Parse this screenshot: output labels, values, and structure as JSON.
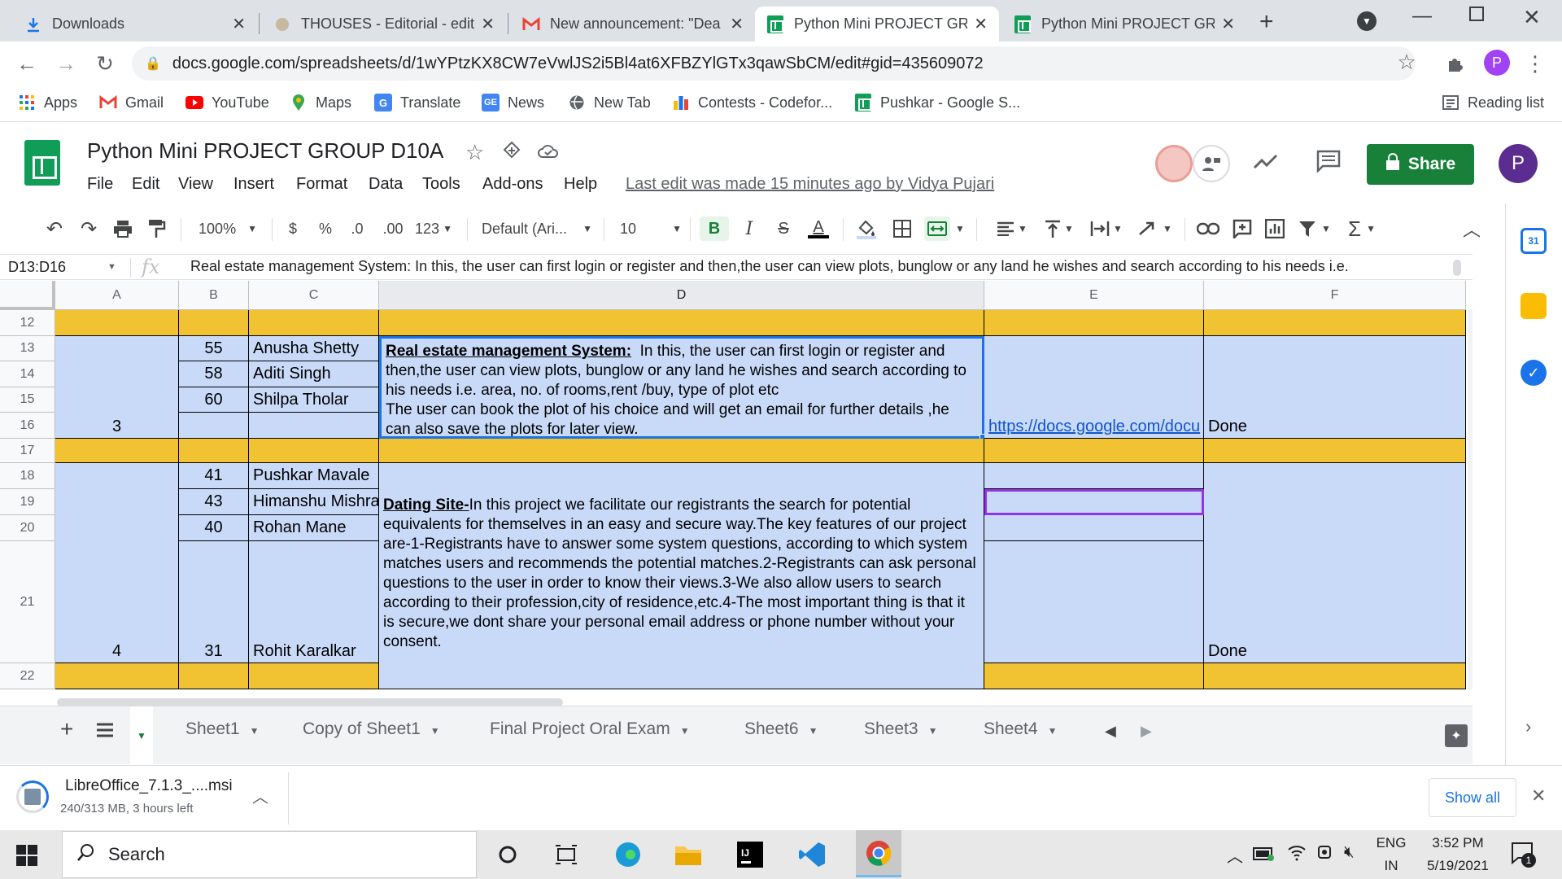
{
  "browser": {
    "tabs": [
      {
        "label": "Downloads",
        "icon": "download-icon"
      },
      {
        "label": "THOUSES - Editorial - edit",
        "icon": "thouses-icon"
      },
      {
        "label": "New announcement: \"Dea",
        "icon": "gmail-icon"
      },
      {
        "label": "Python Mini PROJECT GRO",
        "icon": "sheets-icon"
      },
      {
        "label": "Python Mini PROJECT GRO",
        "icon": "sheets-icon"
      }
    ],
    "url": "docs.google.com/spreadsheets/d/1wYPtzKX8CW7eVwlJS2i5Bl4at6XFBZYlGTx3qawSbCM/edit#gid=435609072",
    "profile_initial": "P",
    "bookmarks": [
      {
        "label": "Apps",
        "icon": "apps-grid-icon"
      },
      {
        "label": "Gmail",
        "icon": "gmail-icon"
      },
      {
        "label": "YouTube",
        "icon": "youtube-icon"
      },
      {
        "label": "Maps",
        "icon": "maps-icon"
      },
      {
        "label": "Translate",
        "icon": "translate-icon"
      },
      {
        "label": "News",
        "icon": "news-icon"
      },
      {
        "label": "New Tab",
        "icon": "globe-icon"
      },
      {
        "label": "Contests - Codefor...",
        "icon": "codeforces-icon"
      },
      {
        "label": "Pushkar - Google S...",
        "icon": "sheets-icon"
      }
    ],
    "reading_list": "Reading list"
  },
  "doc": {
    "title": "Python Mini PROJECT GROUP D10A",
    "menus": [
      "File",
      "Edit",
      "View",
      "Insert",
      "Format",
      "Data",
      "Tools",
      "Add-ons",
      "Help"
    ],
    "last_edit": "Last edit was made 15 minutes ago by Vidya Pujari",
    "share_label": "Share",
    "user_initial": "P"
  },
  "toolbar": {
    "zoom": "100%",
    "currency": "$",
    "percent": "%",
    "dec_less": ".0",
    "dec_more": ".00",
    "format_more": "123",
    "font": "Default (Ari...",
    "font_size": "10",
    "bold": "B",
    "italic": "I",
    "strike": "S",
    "text_color": "A"
  },
  "formula_bar": {
    "name_box": "D13:D16",
    "fx": "fx",
    "content": "Real estate management System:  In this, the user can first login or register and then,the user can view plots, bunglow or any land he wishes and search according to his needs i.e."
  },
  "grid": {
    "columns": [
      "A",
      "B",
      "C",
      "D",
      "E",
      "F"
    ],
    "rows": [
      "12",
      "13",
      "14",
      "15",
      "16",
      "17",
      "18",
      "19",
      "20",
      "21",
      "22"
    ],
    "group3": {
      "group_no": "3",
      "members": [
        {
          "roll": "55",
          "name": "Anusha Shetty"
        },
        {
          "roll": "58",
          "name": "Aditi Singh"
        },
        {
          "roll": "60",
          "name": "Shilpa Tholar"
        }
      ],
      "title": "Real estate management System:",
      "description": "  In this, the user can first login or register and then,the user can view plots, bunglow or any land he wishes and search according to his needs i.e. area, no. of rooms,rent /buy, type of plot etc\nThe user can book the plot of his choice and will get an email for further details ,he can also save the plots for later view.",
      "link": "https://docs.google.com/docu",
      "status": "Done"
    },
    "group4": {
      "group_no": "4",
      "members": [
        {
          "roll": "41",
          "name": "Pushkar Mavale"
        },
        {
          "roll": "43",
          "name": "Himanshu Mishra"
        },
        {
          "roll": "40",
          "name": "Rohan Mane"
        },
        {
          "roll": "31",
          "name": "Rohit Karalkar"
        }
      ],
      "title": "Dating Site-",
      "description": "In this project we facilitate our registrants the search for potential equivalents for themselves in an easy and secure way.The key features of our project are-1-Registrants have to answer some system questions, according to which system matches users and recommends the potential matches.2-Registrants can ask personal questions to the user in order to know their views.3-We also allow users to search according to their profession,city of residence,etc.4-The most important thing is that it is secure,we dont share your personal email address or phone number without your consent.",
      "status": "Done"
    }
  },
  "sheets": [
    "Sheet1",
    "Copy of Sheet1",
    "Final Project Oral Exam",
    "Sheet6",
    "Sheet3",
    "Sheet4"
  ],
  "download": {
    "filename": "LibreOffice_7.1.3_....msi",
    "progress": "240/313 MB, 3 hours left",
    "progress_fraction": 0.767,
    "show_all": "Show all"
  },
  "taskbar": {
    "search": "Search",
    "lang_top": "ENG",
    "lang_bottom": "IN",
    "time": "3:52 PM",
    "date": "5/19/2021",
    "notifications": "1"
  },
  "colors": {
    "yellow": "#f1c232",
    "blue": "#c9daf8",
    "share_green": "#188038",
    "sheets_green": "#0f9d58"
  }
}
